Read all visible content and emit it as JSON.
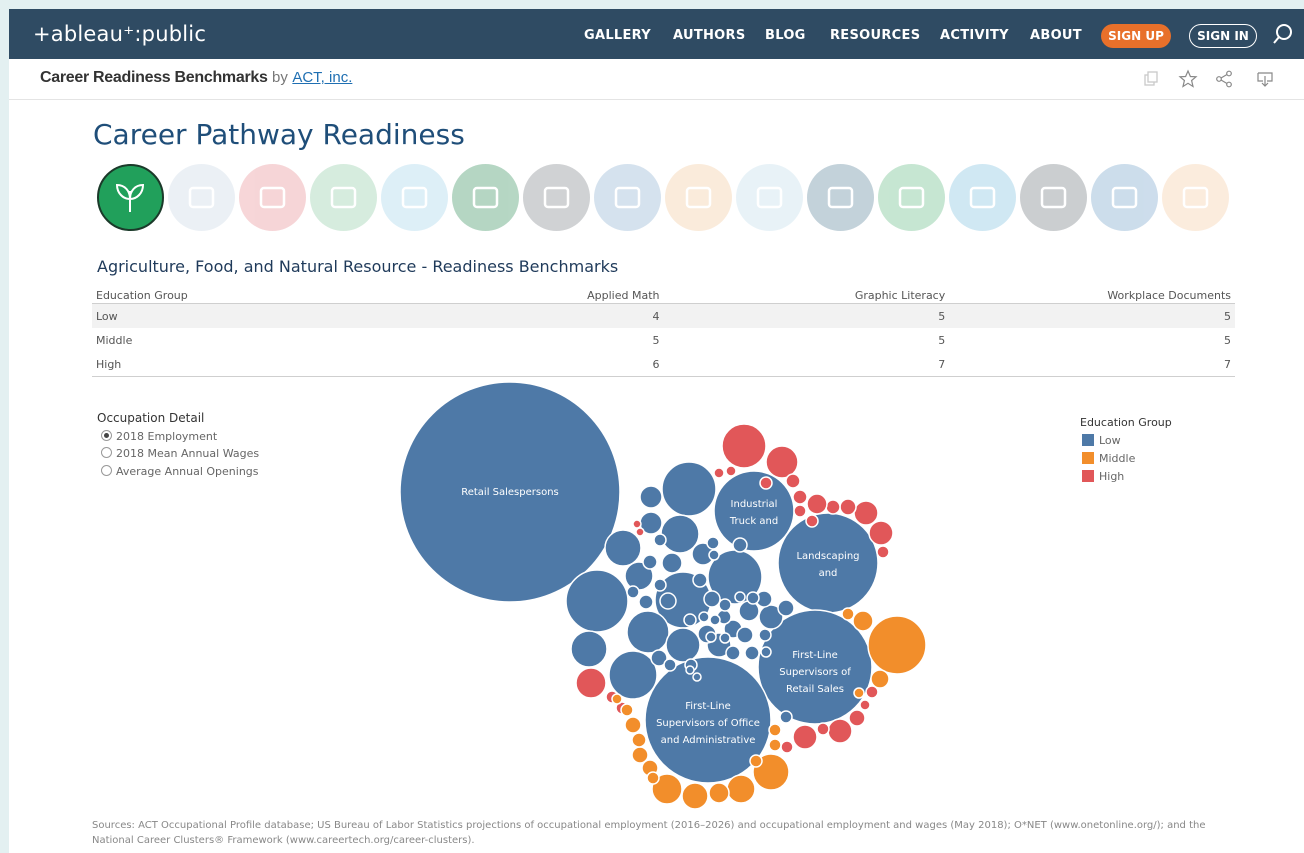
{
  "nav": {
    "logo": "+ableau⁺:public",
    "links": [
      "GALLERY",
      "AUTHORS",
      "BLOG",
      "RESOURCES",
      "ACTIVITY",
      "ABOUT"
    ],
    "signup": "SIGN UP",
    "signin": "SIGN IN"
  },
  "viz": {
    "title": "Career Readiness Benchmarks",
    "by": "by",
    "author": "ACT, inc."
  },
  "dashboard": {
    "title": "Career Pathway Readiness",
    "pathway_icons": [
      "leaf-icon",
      "brick-wall-icon",
      "megaphone-icon",
      "monitor-chart-icon",
      "graduation-cap-icon",
      "money-icon",
      "government-building-icon",
      "syringe-icon",
      "bed-icon",
      "handshake-icon",
      "teacher-board-icon",
      "gavel-icon",
      "tools-icon",
      "bar-chart-up-icon",
      "gear-code-icon",
      "delivery-truck-icon"
    ],
    "pathway_colors": [
      "#21a05b",
      "#c8d6e5",
      "#e88a90",
      "#8cc9a3",
      "#9fd2ea",
      "#2e8b57",
      "#7a7f85",
      "#8aaed0",
      "#f2c89a",
      "#c0dcea",
      "#557f98",
      "#5fb87f",
      "#7bbfdf",
      "#6c747c",
      "#6f9fc8",
      "#f5c9a1"
    ],
    "selected_index": 0
  },
  "benchmarks": {
    "title": "Agriculture, Food, and Natural Resource - Readiness Benchmarks",
    "headers": [
      "Education Group",
      "Applied Math",
      "Graphic Literacy",
      "Workplace Documents"
    ],
    "rows": [
      [
        "Low",
        "4",
        "5",
        "5"
      ],
      [
        "Middle",
        "5",
        "5",
        "5"
      ],
      [
        "High",
        "6",
        "7",
        "7"
      ]
    ]
  },
  "occupation_detail": {
    "title": "Occupation Detail",
    "options": [
      "2018 Employment",
      "2018 Mean Annual Wages",
      "Average Annual Openings"
    ],
    "selected": "2018 Employment"
  },
  "legend": {
    "title": "Education Group",
    "items": [
      {
        "label": "Low",
        "color": "#4e79a7"
      },
      {
        "label": "Middle",
        "color": "#f28e2b"
      },
      {
        "label": "High",
        "color": "#e15759"
      }
    ]
  },
  "chart_data": {
    "type": "bubble",
    "labels": [
      "Retail Salespersons",
      "Industrial Truck and",
      "Landscaping and",
      "First-Line Supervisors of Retail Sales",
      "First-Line Supervisors of Office and Administrative"
    ],
    "legend_title": "Education Group"
  },
  "sources": "Sources: ACT Occupational Profile database; US Bureau of Labor Statistics projections of occupational employment (2016–2026) and occupational employment and wages (May 2018); O*NET (www.onetonline.org/); and the National Career Clusters® Framework (www.careertech.org/career-clusters)."
}
